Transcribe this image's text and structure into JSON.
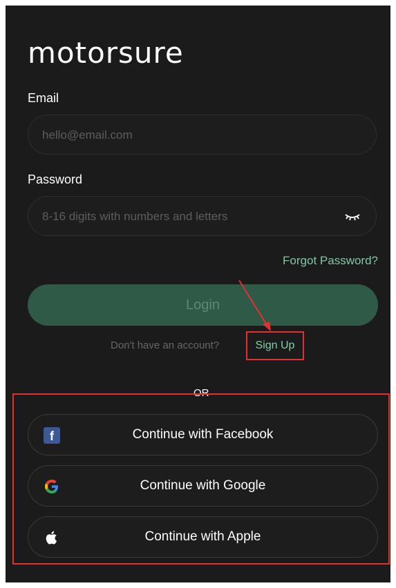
{
  "app": {
    "logo": "motorsure"
  },
  "email": {
    "label": "Email",
    "placeholder": "hello@email.com"
  },
  "password": {
    "label": "Password",
    "placeholder": "8-16 digits with numbers and letters"
  },
  "links": {
    "forgot": "Forgot Password?",
    "no_account": "Don't have an account?",
    "signup": "Sign Up"
  },
  "login": {
    "label": "Login"
  },
  "divider": {
    "text": "OR"
  },
  "social": {
    "facebook": "Continue with Facebook",
    "google": "Continue with Google",
    "apple": "Continue with Apple"
  },
  "colors": {
    "background": "#1b1b1b",
    "accent": "#7fc8a5",
    "login_bg": "#2f5a47",
    "annotation": "#e53030"
  }
}
